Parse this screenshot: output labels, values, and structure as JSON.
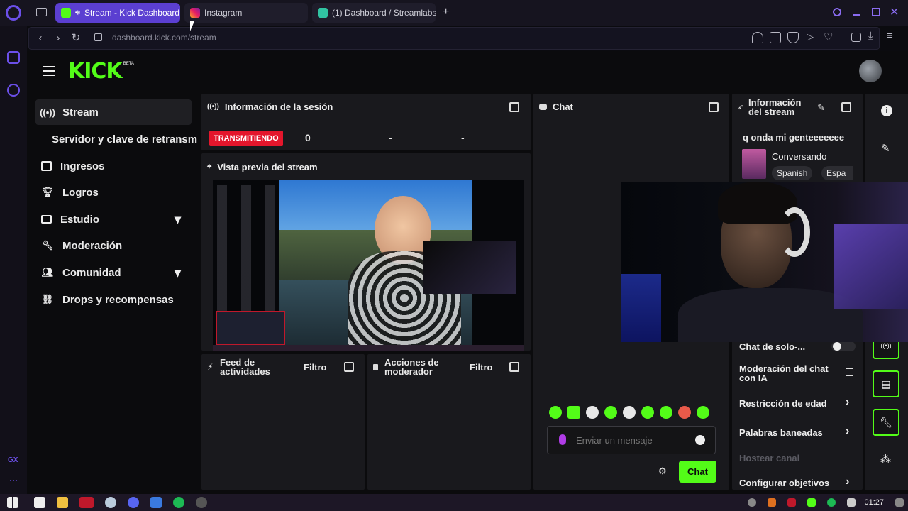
{
  "browser": {
    "tabs": [
      {
        "label": "Stream - Kick Dashboard",
        "active": true
      },
      {
        "label": "Instagram",
        "active": false
      },
      {
        "label": "(1) Dashboard / Streamlabs",
        "active": false
      }
    ],
    "url": "dashboard.kick.com/stream",
    "new_tab": "+"
  },
  "kick": {
    "logo": "KICK",
    "logo_badge": "BETA"
  },
  "sidebar": {
    "items": [
      {
        "label": "Stream",
        "icon": "broadcast-icon"
      },
      {
        "label": "Servidor y clave de retransm"
      },
      {
        "label": "Ingresos",
        "icon": "chart-icon"
      },
      {
        "label": "Logros",
        "icon": "trophy-icon"
      },
      {
        "label": "Estudio",
        "icon": "studio-icon",
        "chevron": "▾"
      },
      {
        "label": "Moderación",
        "icon": "wrench-icon"
      },
      {
        "label": "Comunidad",
        "icon": "community-icon",
        "chevron": "▾"
      },
      {
        "label": "Drops y recompensas",
        "icon": "drops-icon"
      }
    ]
  },
  "session": {
    "title": "Información de la sesión",
    "status": "TRANSMITIENDO",
    "viewers": "0",
    "dash1": "-",
    "dash2": "-"
  },
  "preview": {
    "title": "Vista previa del stream"
  },
  "feed": {
    "title": "Feed de actividades",
    "filter": "Filtro"
  },
  "modactions": {
    "title": "Acciones de moderador",
    "filter": "Filtro"
  },
  "chat": {
    "title": "Chat",
    "placeholder": "Enviar un mensaje",
    "send": "Chat"
  },
  "stream_info": {
    "title": "Información del stream",
    "stream_title": "q onda mi genteeeeeee",
    "category": "Conversando",
    "tags": [
      "Spanish",
      "Espa"
    ]
  },
  "settings": {
    "solo_chat": "Chat de solo-...",
    "ai_moderation": "Moderación del chat con IA",
    "age_restriction": "Restricción de edad",
    "banned_words": "Palabras baneadas",
    "host": "Hostear canal",
    "goals": "Configurar objetivos"
  },
  "taskbar": {
    "clock": "01:27"
  },
  "colors": {
    "kick_green": "#53fc18",
    "live_red": "#e4162c",
    "opera_purple": "#5b3fd1"
  }
}
